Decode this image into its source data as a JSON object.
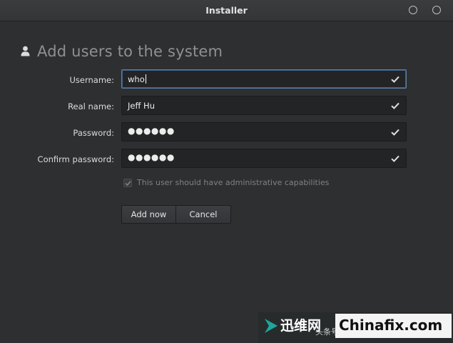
{
  "window": {
    "title": "Installer"
  },
  "page": {
    "title": "Add users to the system"
  },
  "form": {
    "fields": [
      {
        "label": "Username:",
        "value": "who",
        "focused": true
      },
      {
        "label": "Real name:",
        "value": "Jeff Hu"
      },
      {
        "label": "Password:",
        "value": "●●●●●●"
      },
      {
        "label": "Confirm password:",
        "value": "●●●●●●"
      }
    ],
    "admin": {
      "label": "This user should have administrative capabilities",
      "checked": true
    }
  },
  "buttons": {
    "add": "Add now",
    "cancel": "Cancel"
  },
  "watermark": {
    "cn": "迅维网",
    "sub": "头条号 / 知数码行天下",
    "brand": "Chinafix.com"
  },
  "colors": {
    "background": "#2d2f31",
    "field": "#232425",
    "focus": "#5a7ea8",
    "accent": "#1fa69a"
  }
}
